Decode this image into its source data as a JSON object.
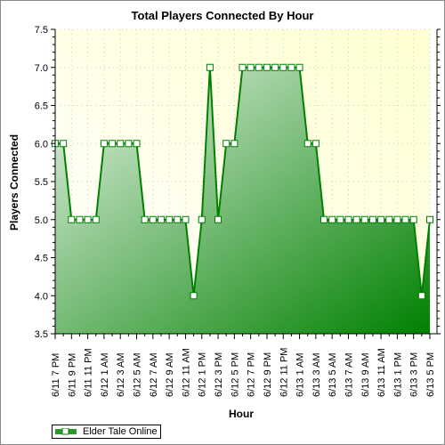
{
  "chart_data": {
    "type": "area",
    "title": "Total Players Connected By Hour",
    "xlabel": "Hour",
    "ylabel": "Players Connected",
    "ylim": [
      3.5,
      7.5
    ],
    "yticks": [
      "3.5",
      "4.0",
      "4.5",
      "5.0",
      "5.5",
      "6.0",
      "6.5",
      "7.0",
      "7.5"
    ],
    "grid": true,
    "legend_placement": "bottom-left",
    "series": [
      {
        "name": "Elder Tale Online",
        "color": "#008000",
        "values": [
          6,
          6,
          5,
          5,
          5,
          5,
          6,
          6,
          6,
          6,
          6,
          5,
          5,
          5,
          5,
          5,
          5,
          4,
          5,
          7,
          5,
          6,
          6,
          7,
          7,
          7,
          7,
          7,
          7,
          7,
          7,
          6,
          6,
          5,
          5,
          5,
          5,
          5,
          5,
          5,
          5,
          5,
          5,
          5,
          5,
          4,
          5
        ]
      }
    ],
    "x": [
      "6/11 7 PM",
      "6/11 8 PM",
      "6/11 9 PM",
      "6/11 10 PM",
      "6/11 11 PM",
      "6/12 12 AM",
      "6/12 1 AM",
      "6/12 2 AM",
      "6/12 3 AM",
      "6/12 4 AM",
      "6/12 5 AM",
      "6/12 6 AM",
      "6/12 7 AM",
      "6/12 8 AM",
      "6/12 9 AM",
      "6/12 10 AM",
      "6/12 11 AM",
      "6/12 12 PM",
      "6/12 1 PM",
      "6/12 2 PM",
      "6/12 3 PM",
      "6/12 4 PM",
      "6/12 5 PM",
      "6/12 6 PM",
      "6/12 7 PM",
      "6/12 8 PM",
      "6/12 9 PM",
      "6/12 10 PM",
      "6/12 11 PM",
      "6/13 12 AM",
      "6/13 1 AM",
      "6/13 2 AM",
      "6/13 3 AM",
      "6/13 4 AM",
      "6/13 5 AM",
      "6/13 6 AM",
      "6/13 7 AM",
      "6/13 8 AM",
      "6/13 9 AM",
      "6/13 10 AM",
      "6/13 11 AM",
      "6/13 12 PM",
      "6/13 1 PM",
      "6/13 2 PM",
      "6/13 3 PM",
      "6/13 4 PM",
      "6/13 5 PM"
    ],
    "xtick_labels": [
      "6/11 7 PM",
      "6/11 9 PM",
      "6/11 11 PM",
      "6/12 1 AM",
      "6/12 3 AM",
      "6/12 5 AM",
      "6/12 7 AM",
      "6/12 9 AM",
      "6/12 11 AM",
      "6/12 1 PM",
      "6/12 3 PM",
      "6/12 5 PM",
      "6/12 7 PM",
      "6/12 9 PM",
      "6/12 11 PM",
      "6/13 1 AM",
      "6/13 3 AM",
      "6/13 5 AM",
      "6/13 7 AM",
      "6/13 9 AM",
      "6/13 11 AM",
      "6/13 1 PM",
      "6/13 3 PM",
      "6/13 5 PM"
    ]
  }
}
